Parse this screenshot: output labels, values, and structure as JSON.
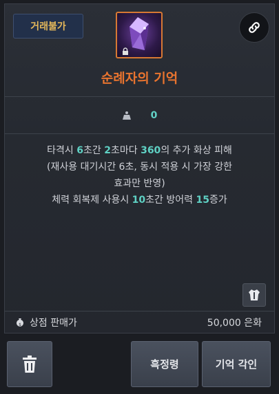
{
  "tag_label": "거래불가",
  "item": {
    "name": "순례자의 기억",
    "stat_value": "0"
  },
  "description": {
    "l1": [
      "타격시 ",
      "6",
      "초간 ",
      "2",
      "초마다 ",
      "360",
      "의 추가 화상 피해"
    ],
    "l2": "(재사용 대기시간 6초, 동시 적용 시 가장 강한",
    "l3": "효과만 반영)",
    "l4": [
      "체력 회복제 사용시 ",
      "10",
      "초간 방어력 ",
      "15",
      "증가"
    ]
  },
  "price": {
    "label": "상점 판매가",
    "value": "50,000 은화"
  },
  "buttons": {
    "extract": "흑정령",
    "engrave": "기억 각인"
  },
  "colors": {
    "title": "#e9742f",
    "tag": "#e5b85a",
    "highlight": "#5fd1c4"
  },
  "icons": {
    "link": "link-icon",
    "weight": "weight-icon",
    "armor": "armor-icon",
    "money": "money-bag-icon",
    "trash": "trash-icon",
    "lock": "lock-icon"
  }
}
